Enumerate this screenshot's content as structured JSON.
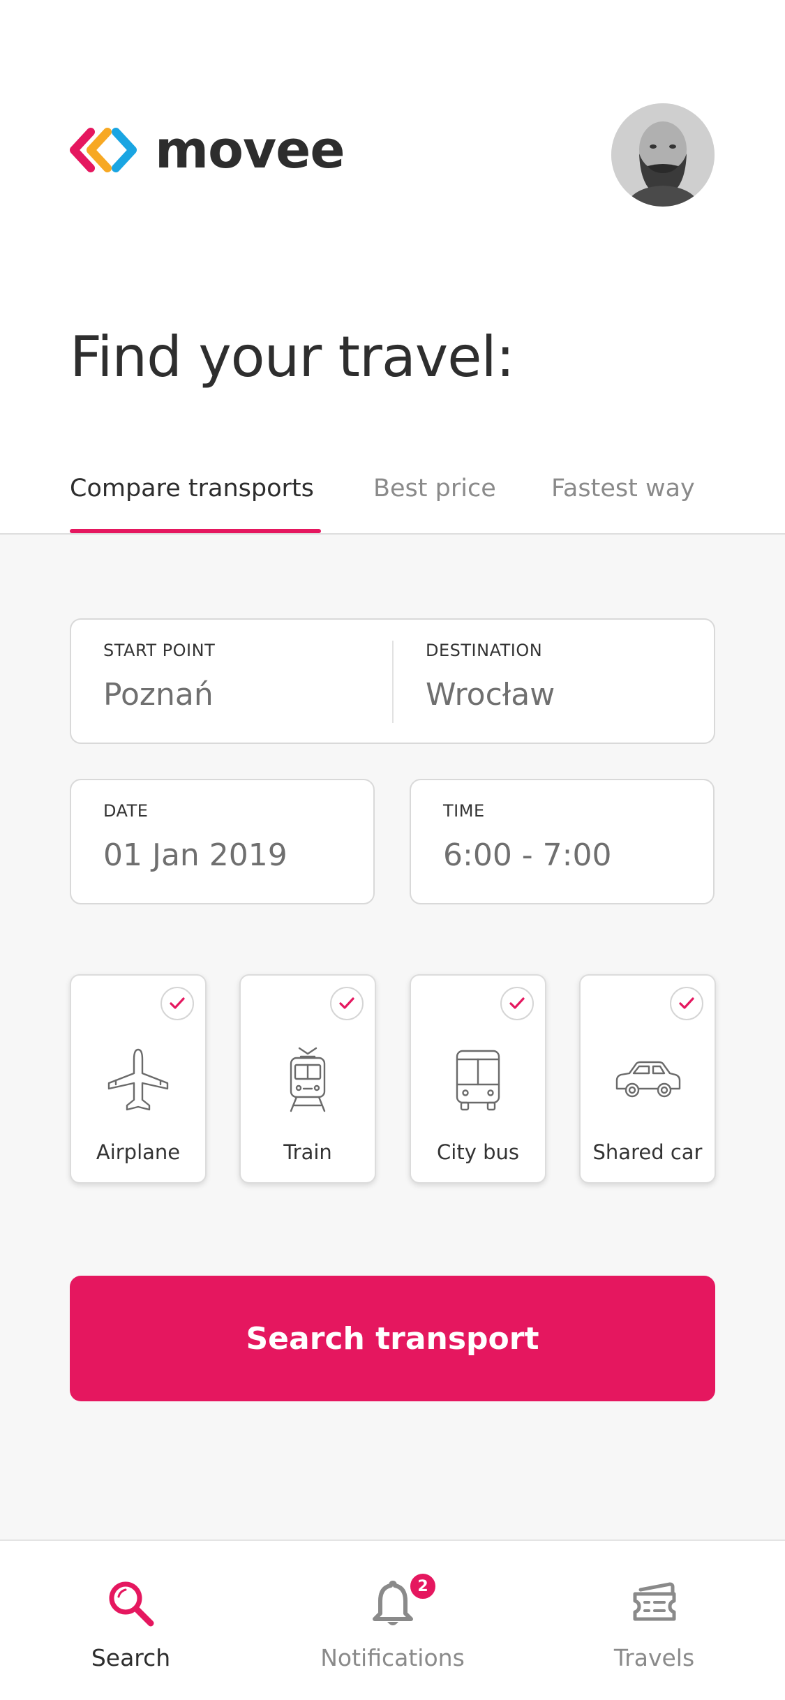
{
  "app": {
    "brand_name": "movee",
    "brand_colors": {
      "pink": "#e5175f",
      "orange": "#f7a823",
      "blue": "#1aa5e2"
    }
  },
  "header": {
    "avatar_icon": "user-avatar",
    "title": "Find your travel:"
  },
  "tabs": [
    {
      "label": "Compare transports",
      "active": true
    },
    {
      "label": "Best price",
      "active": false
    },
    {
      "label": "Fastest way",
      "active": false
    }
  ],
  "form": {
    "start": {
      "label": "START POINT",
      "value": "Poznań"
    },
    "destination": {
      "label": "DESTINATION",
      "value": "Wrocław"
    },
    "date": {
      "label": "DATE",
      "value": "01 Jan 2019"
    },
    "time": {
      "label": "TIME",
      "value": "6:00 - 7:00"
    }
  },
  "transports": [
    {
      "label": "Airplane",
      "icon": "airplane-icon",
      "checked": true
    },
    {
      "label": "Train",
      "icon": "train-icon",
      "checked": true
    },
    {
      "label": "City bus",
      "icon": "bus-icon",
      "checked": true
    },
    {
      "label": "Shared car",
      "icon": "car-icon",
      "checked": true
    }
  ],
  "search_button": {
    "label": "Search transport"
  },
  "bottom_nav": [
    {
      "label": "Search",
      "icon": "search-icon",
      "active": true
    },
    {
      "label": "Notifications",
      "icon": "bell-icon",
      "badge": "2",
      "active": false
    },
    {
      "label": "Travels",
      "icon": "ticket-icon",
      "active": false
    }
  ],
  "colors": {
    "accent": "#e5175f",
    "background": "#f7f7f7",
    "text": "#2d2d2d",
    "muted": "#8a8a8a"
  }
}
